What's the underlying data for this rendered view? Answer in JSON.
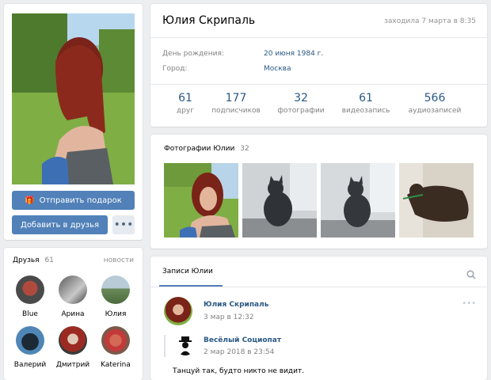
{
  "left": {
    "gift_button": "Отправить подарок",
    "add_friend_button": "Добавить в друзья",
    "more_button": "•••"
  },
  "friends": {
    "title": "Друзья",
    "count": "61",
    "news_link": "новости",
    "items": [
      {
        "name": "Blue"
      },
      {
        "name": "Арина"
      },
      {
        "name": "Юлия"
      },
      {
        "name": "Валерий"
      },
      {
        "name": "Дмитрий"
      },
      {
        "name": "Katerina"
      }
    ]
  },
  "profile": {
    "name": "Юлия Скрипаль",
    "last_seen": "заходила 7 марта в 8:35",
    "birthday_label": "День рождения:",
    "birthday_value": "20 июня 1984 г.",
    "city_label": "Город:",
    "city_value": "Москва",
    "stats": [
      {
        "value": "61",
        "label": "друг"
      },
      {
        "value": "177",
        "label": "подписчиков"
      },
      {
        "value": "32",
        "label": "фотографии"
      },
      {
        "value": "61",
        "label": "видеозапись"
      },
      {
        "value": "566",
        "label": "аудиозаписей"
      }
    ]
  },
  "photos": {
    "title": "Фотографии Юлии",
    "count": "32"
  },
  "wall": {
    "tab_label": "Записи Юлии",
    "post": {
      "author": "Юлия Скрипаль",
      "date": "3 мар в 12:32",
      "more": "•••",
      "repost_author": "Весёлый Социопат",
      "repost_date": "2 мар 2018 в 23:54",
      "text": "Танцуй так, будто никто не видит."
    }
  },
  "colors": {
    "page_bg": "#edeef0",
    "accent": "#5181b8",
    "link": "#2a5885",
    "muted": "#828282"
  }
}
